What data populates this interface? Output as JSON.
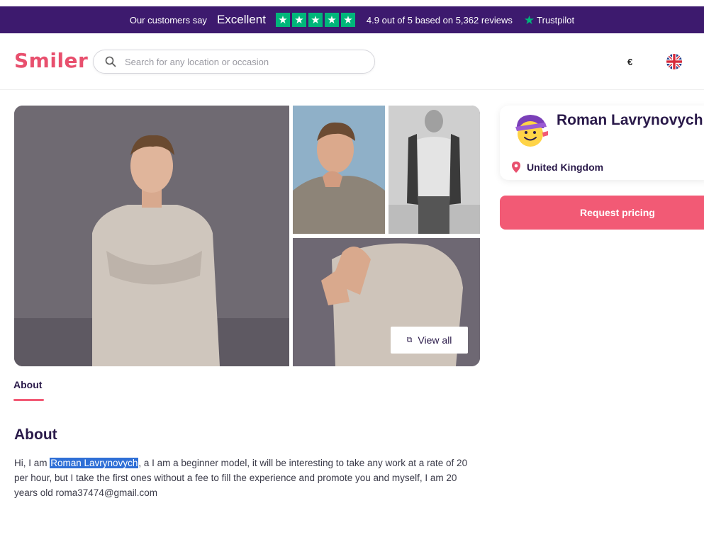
{
  "trustpilot": {
    "customers_say": "Our customers say",
    "excellent": "Excellent",
    "stars": 5,
    "rating_text": "4.9 out of 5 based on 5,362 reviews",
    "brand": "Trustpilot",
    "brand_color": "#00b67a",
    "bar_color": "#3d1a6e"
  },
  "header": {
    "logo": "Smiler",
    "search": {
      "placeholder": "Search for any location or occasion",
      "value": ""
    },
    "currency": "€",
    "language_icon": "uk-flag-icon"
  },
  "gallery": {
    "photos": [
      {
        "alt": "Model portrait standing with crossed arms"
      },
      {
        "alt": "Model close-up with hand on chin"
      },
      {
        "alt": "Model black and white full body"
      },
      {
        "alt": "Model t-shirt close-up"
      }
    ],
    "view_all_label": "View all",
    "view_all_icon": "gallery-icon"
  },
  "profile": {
    "name": "Roman Lavrynovych",
    "location": "United Kingdom",
    "request_label": "Request pricing",
    "accent": "#f25a75"
  },
  "tabs": {
    "about": "About"
  },
  "about": {
    "heading": "About",
    "text_before": "Hi, I am ",
    "highlighted": "Roman Lavrynovych",
    "text_after": ", a I am a beginner model, it will be interesting to take any work at a rate of 20 per hour, but I take the first ones without a fee to fill the experience and promote you and myself, I am 20 years old roma37474@gmail.com"
  }
}
